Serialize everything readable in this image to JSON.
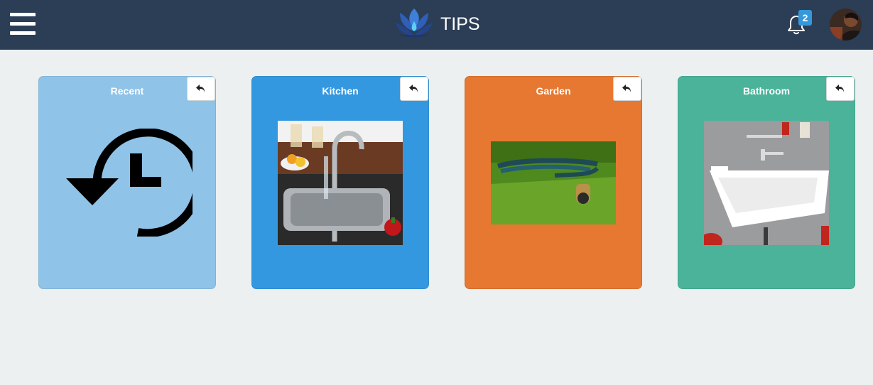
{
  "header": {
    "title": "TIPS",
    "menu_icon": "hamburger-menu-icon",
    "logo_icon": "lotus-water-drop-logo",
    "notification_icon": "bell-icon",
    "notification_count": "2",
    "avatar": "user-avatar-photo"
  },
  "cards": [
    {
      "label": "Recent",
      "color": "#8fc3e8",
      "icon": "history-clock-icon",
      "action_icon": "reply-arrow-icon"
    },
    {
      "label": "Kitchen",
      "color": "#3498e0",
      "image": "kitchen-sink-photo",
      "action_icon": "reply-arrow-icon"
    },
    {
      "label": "Garden",
      "color": "#e67832",
      "image": "garden-hose-on-grass-photo",
      "action_icon": "reply-arrow-icon"
    },
    {
      "label": "Bathroom",
      "color": "#4ab39a",
      "image": "bathroom-basin-photo",
      "action_icon": "reply-arrow-icon"
    }
  ],
  "colors": {
    "header_bg": "#2c3e55",
    "page_bg": "#ecf0f1",
    "badge_bg": "#3498db"
  }
}
